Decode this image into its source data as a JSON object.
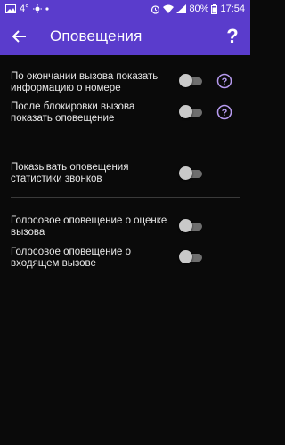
{
  "status_bar": {
    "left_text": "4°",
    "battery": "80%",
    "time": "17:54"
  },
  "header": {
    "title": "Оповещения",
    "help_label": "?"
  },
  "settings": [
    {
      "label": "По окончании вызова показать информацию о номере",
      "enabled": false,
      "has_help": true
    },
    {
      "label": "После блокировки вызова показать оповещение",
      "enabled": false,
      "has_help": true
    },
    {
      "label": "Показывать оповещения статистики звонков",
      "enabled": false,
      "has_help": false
    },
    {
      "label": "Голосовое оповещение о оценке вызова",
      "enabled": false,
      "has_help": false
    },
    {
      "label": "Голосовое оповещение о входящем вызове",
      "enabled": false,
      "has_help": false
    }
  ],
  "colors": {
    "accent": "#5a3ccc",
    "help_icon": "#b79bf0",
    "background": "#0a0a0a"
  }
}
